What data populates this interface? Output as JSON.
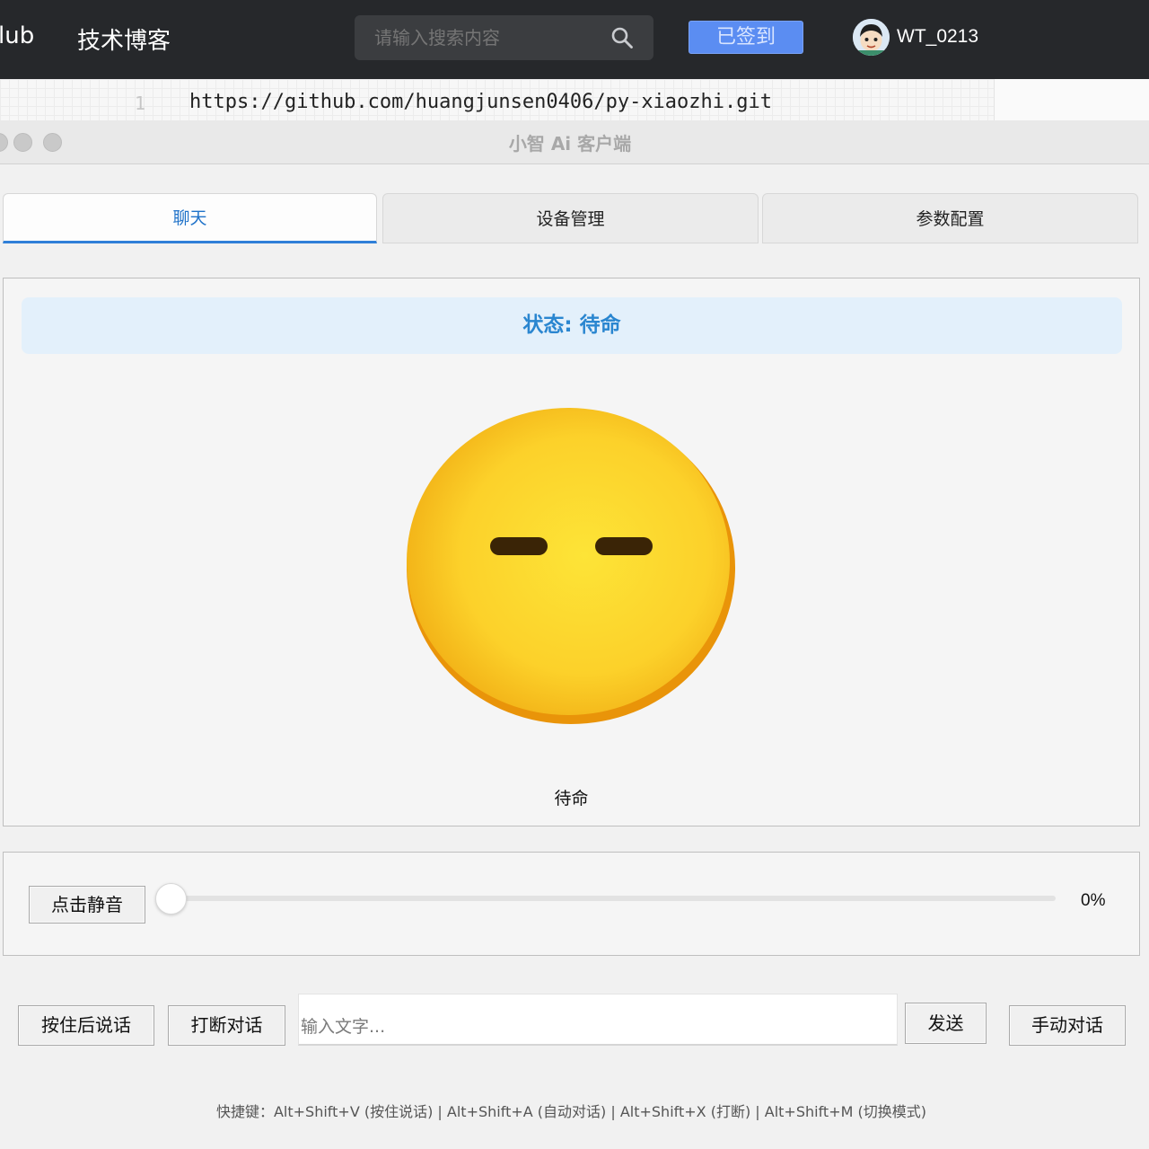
{
  "site": {
    "brand_partial": "lub",
    "blog_link": "技术博客",
    "search_placeholder": "请输入搜索内容",
    "signed_in_button": "已签到",
    "username": "WT_0213"
  },
  "editor": {
    "line_number": "1",
    "code_line": "https://github.com/huangjunsen0406/py-xiaozhi.git"
  },
  "window": {
    "title": "小智 Ai 客户端"
  },
  "tabs": [
    {
      "label": "聊天",
      "active": true
    },
    {
      "label": "设备管理",
      "active": false
    },
    {
      "label": "参数配置",
      "active": false
    }
  ],
  "chat": {
    "status_text": "状态: 待命",
    "emotion_icon": "expressionless-face-emoji",
    "emotion_label": "待命"
  },
  "volume": {
    "mute_button": "点击静音",
    "level_percent": 0,
    "level_text": "0%"
  },
  "controls": {
    "hold_to_talk_button": "按住后说话",
    "interrupt_button": "打断对话",
    "text_input_placeholder": "输入文字...",
    "send_button": "发送",
    "manual_mode_button": "手动对话"
  },
  "shortcuts_text": "快捷键：Alt+Shift+V (按住说话) | Alt+Shift+A (自动对话) | Alt+Shift+X (打断) | Alt+Shift+M (切换模式)",
  "colors": {
    "topbar_bg": "#26282b",
    "accent_blue": "#2f7fd8",
    "status_bg": "#e3f0fb",
    "status_text": "#2a86d0",
    "signed_button_bg": "#5b8df2",
    "emoji_yellow": "#fcd42c",
    "emoji_orange": "#e99409"
  }
}
